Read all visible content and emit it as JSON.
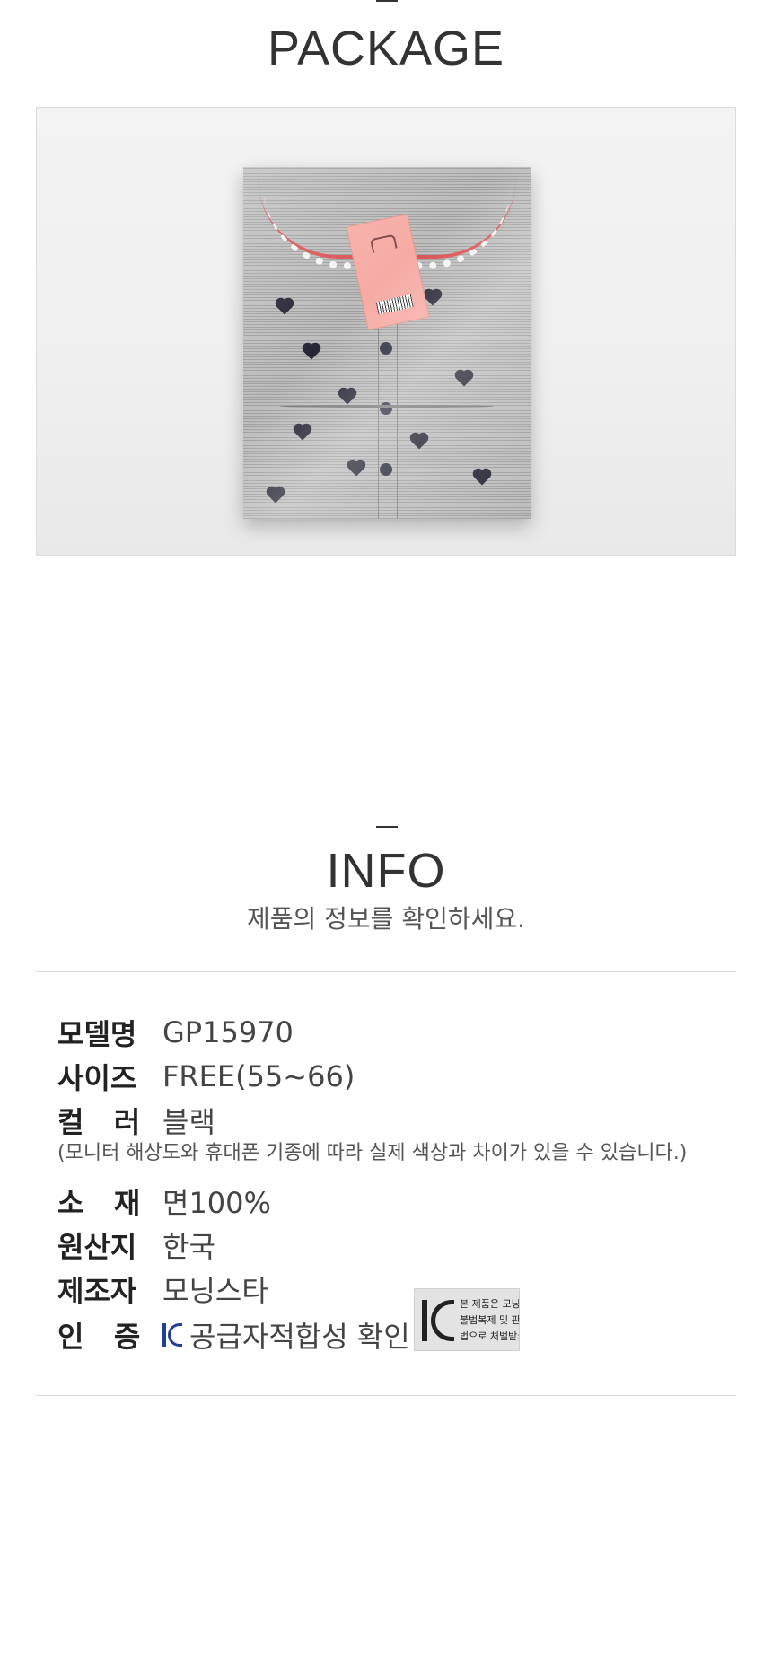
{
  "package": {
    "title": "PACKAGE"
  },
  "info": {
    "title": "INFO",
    "subtitle": "제품의 정보를 확인하세요.",
    "rows": [
      {
        "label": "모델명",
        "value": "GP15970"
      },
      {
        "label": "사이즈",
        "value": "FREE(55~66)"
      },
      {
        "label": "컬   러",
        "value": "블랙"
      },
      {
        "label": "소   재",
        "value": "면100%"
      },
      {
        "label": "원산지",
        "value": "한국"
      },
      {
        "label": "제조자",
        "value": "모닝스타"
      },
      {
        "label": "인   증",
        "value": "공급자적합성 확인"
      }
    ],
    "color_note": "(모니터 해상도와 휴대폰 기종에 따라 실제 색상과 차이가 있을 수 있습니다.)",
    "kc_box_lines": [
      "본 제품은 모닝",
      "불법복제 및 판",
      "법으로 처벌받:"
    ]
  },
  "icons": {
    "kc": "kc-certification-icon"
  }
}
